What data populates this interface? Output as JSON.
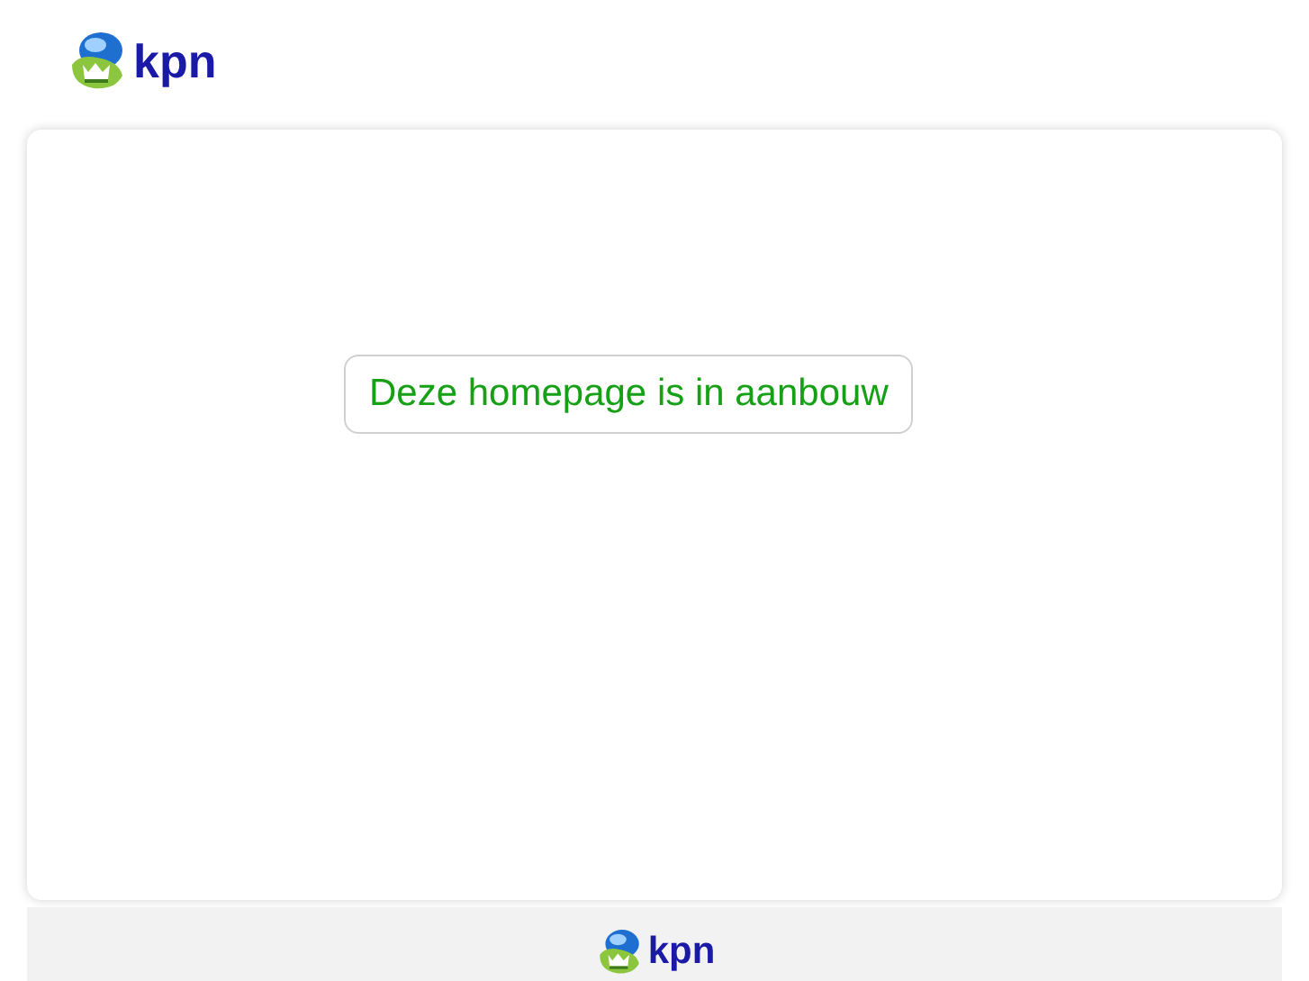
{
  "header": {
    "logo_text": "kpn"
  },
  "main": {
    "message": "Deze homepage is in aanbouw"
  },
  "footer": {
    "logo_text": "kpn"
  }
}
